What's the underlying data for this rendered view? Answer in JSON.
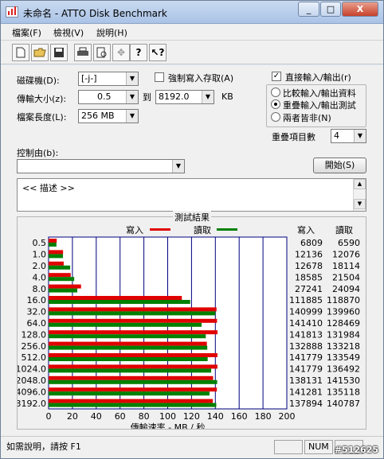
{
  "window": {
    "title": "未命名 - ATTO Disk Benchmark",
    "buttons": [
      "_",
      "□",
      "X"
    ]
  },
  "menu": [
    "檔案(F)",
    "檢視(V)",
    "說明(H)"
  ],
  "toolbar": [
    "new-document-icon",
    "open-folder-icon",
    "save-icon",
    "print-icon",
    "print-preview-icon",
    "move-icon",
    "help-icon",
    "context-help-icon"
  ],
  "form": {
    "drive_label": "磁碟機(D):",
    "drive_value": "[-j-]",
    "force_write_label": "強制寫入存取(A)",
    "force_write_checked": false,
    "transfer_label": "傳輸大小(z):",
    "transfer_from": "0.5",
    "transfer_to_label": "到",
    "transfer_to": "8192.0",
    "transfer_unit": "KB",
    "length_label": "檔案長度(L):",
    "length_value": "256 MB",
    "direct_io_label": "直接輸入/輸出(r)",
    "direct_io_checked": true,
    "radio_compare": "比較輸入/輸出資料",
    "radio_overlap": "重疊輸入/輸出測試",
    "radio_neither": "兩者皆非(N)",
    "queue_label": "重疊項目數",
    "queue_value": "4",
    "controlled_label": "控制由(b):",
    "controlled_value": "",
    "start_button": "開始(S)",
    "description": "<<     描述     >>"
  },
  "chart_data": {
    "type": "bar",
    "title": "測試結果",
    "legend": {
      "write": "寫入",
      "read": "讀取",
      "placement": "top"
    },
    "colors": {
      "write": "#e00000",
      "read": "#008000"
    },
    "xlabel": "傳輸速率 - MB / 秒",
    "xlim": [
      0,
      200
    ],
    "xticks": [
      "0",
      "20",
      "40",
      "60",
      "80",
      "100",
      "120",
      "140",
      "160",
      "180",
      "200"
    ],
    "categories": [
      "0.5",
      "1.0",
      "2.0",
      "4.0",
      "8.0",
      "16.0",
      "32.0",
      "64.0",
      "128.0",
      "256.0",
      "512.0",
      "1024.0",
      "2048.0",
      "4096.0",
      "3192.0"
    ],
    "series": [
      {
        "name": "寫入",
        "values": [
          6809,
          12136,
          12678,
          18585,
          27241,
          111885,
          140999,
          141410,
          141813,
          132888,
          141779,
          141779,
          138131,
          141281,
          137894
        ]
      },
      {
        "name": "讀取",
        "values": [
          6590,
          12076,
          18114,
          21504,
          24094,
          118870,
          139960,
          128469,
          131984,
          133218,
          133549,
          136492,
          141530,
          135118,
          140787
        ]
      }
    ],
    "table_headers": [
      "寫入",
      "讀取"
    ]
  },
  "status": {
    "help": "如需說明，請按 F1",
    "num": "NUM",
    "watermark": "#512625"
  }
}
